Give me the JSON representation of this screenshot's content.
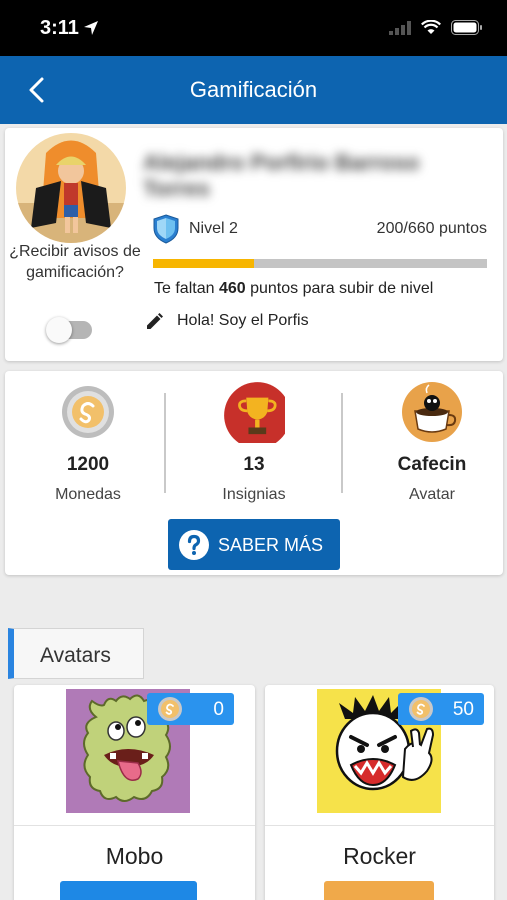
{
  "status_bar": {
    "time": "3:11"
  },
  "header": {
    "title": "Gamificación"
  },
  "profile": {
    "user_name": "Alejandro Porfirio Barroso Torres",
    "notify_label": "¿Recibir avisos de gamificación?",
    "notify_enabled": false,
    "level_label": "Nivel 2",
    "points_label": "200/660 puntos",
    "progress_fraction": 0.303,
    "missing_prefix": "Te faltan ",
    "missing_points": "460",
    "missing_suffix": " puntos para subir de nivel",
    "status_message": "Hola! Soy el Porfis"
  },
  "stats": [
    {
      "value": "1200",
      "label": "Monedas",
      "icon": "coin-icon"
    },
    {
      "value": "13",
      "label": "Insignias",
      "icon": "trophy-icon"
    },
    {
      "value": "Cafecin",
      "label": "Avatar",
      "icon": "coffee-avatar-icon"
    }
  ],
  "saber_mas_label": "SABER MÁS",
  "section_title": "Avatars",
  "avatars": [
    {
      "name": "Mobo",
      "price": "0",
      "button_color": "#1e88e5"
    },
    {
      "name": "Rocker",
      "price": "50",
      "button_color": "#f0a94a"
    }
  ],
  "colors": {
    "primary": "#0d64b0",
    "progress": "#f7b500",
    "badge": "#2a93ee",
    "section_accent": "#2a84e0"
  }
}
